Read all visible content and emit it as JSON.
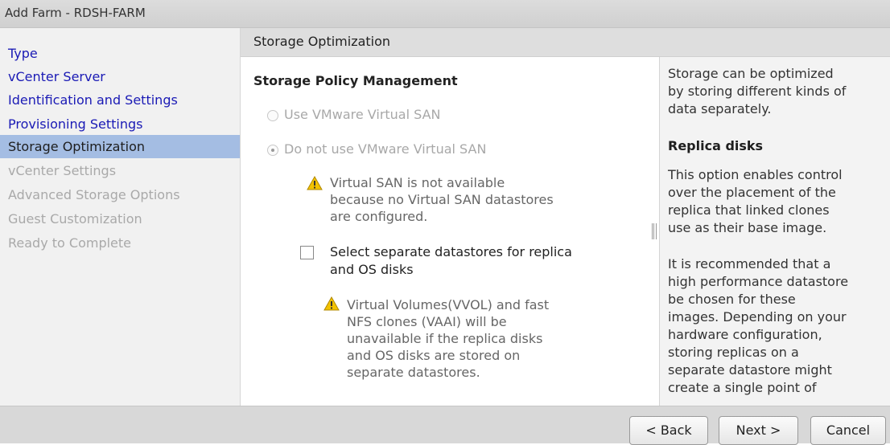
{
  "window": {
    "title": "Add Farm - RDSH-FARM"
  },
  "nav": {
    "items": [
      {
        "label": "Type",
        "state": "done"
      },
      {
        "label": "vCenter Server",
        "state": "done"
      },
      {
        "label": "Identification and Settings",
        "state": "done"
      },
      {
        "label": "Provisioning Settings",
        "state": "done"
      },
      {
        "label": "Storage Optimization",
        "state": "active"
      },
      {
        "label": "vCenter Settings",
        "state": "disabled"
      },
      {
        "label": "Advanced Storage Options",
        "state": "disabled"
      },
      {
        "label": "Guest Customization",
        "state": "disabled"
      },
      {
        "label": "Ready to Complete",
        "state": "disabled"
      }
    ]
  },
  "section": {
    "title": "Storage Optimization"
  },
  "main": {
    "heading": "Storage Policy Management",
    "radio_vsan": {
      "label": "Use VMware Virtual SAN",
      "checked": false,
      "disabled": true
    },
    "radio_no_vsan": {
      "label": "Do not use VMware Virtual SAN",
      "checked": true,
      "disabled": true
    },
    "warning1": {
      "icon": "warning-icon",
      "lines": [
        "Virtual SAN is not available",
        "because no Virtual SAN datastores",
        "are configured."
      ]
    },
    "separate_checkbox": {
      "checked": false,
      "lines": [
        "Select separate datastores for replica",
        "and OS disks"
      ]
    },
    "warning2": {
      "icon": "warning-icon",
      "lines": [
        "Virtual Volumes(VVOL) and fast",
        "NFS clones (VAAI) will be",
        "unavailable if the replica disks",
        "and OS disks are stored on",
        "separate datastores."
      ]
    }
  },
  "help": {
    "intro_lines": [
      "Storage can be optimized",
      "by storing different kinds of",
      "data separately."
    ],
    "replica_heading": "Replica disks",
    "para1_lines": [
      "This option enables control",
      "over the placement of the",
      "replica that linked clones",
      "use as their base image."
    ],
    "para2_lines": [
      "It is recommended that a",
      "high performance datastore",
      "be chosen for these",
      "images. Depending on your",
      "hardware configuration,",
      "storing replicas on a",
      "separate datastore might",
      "create a single point of"
    ]
  },
  "footer": {
    "back_label": "< Back",
    "next_label": "Next >",
    "cancel_label": "Cancel"
  },
  "colors": {
    "nav_done": "#1a1ab5",
    "nav_active_bg": "#a4bde3",
    "nav_disabled": "#a9a9a9",
    "warning_yellow": "#f2c200"
  }
}
